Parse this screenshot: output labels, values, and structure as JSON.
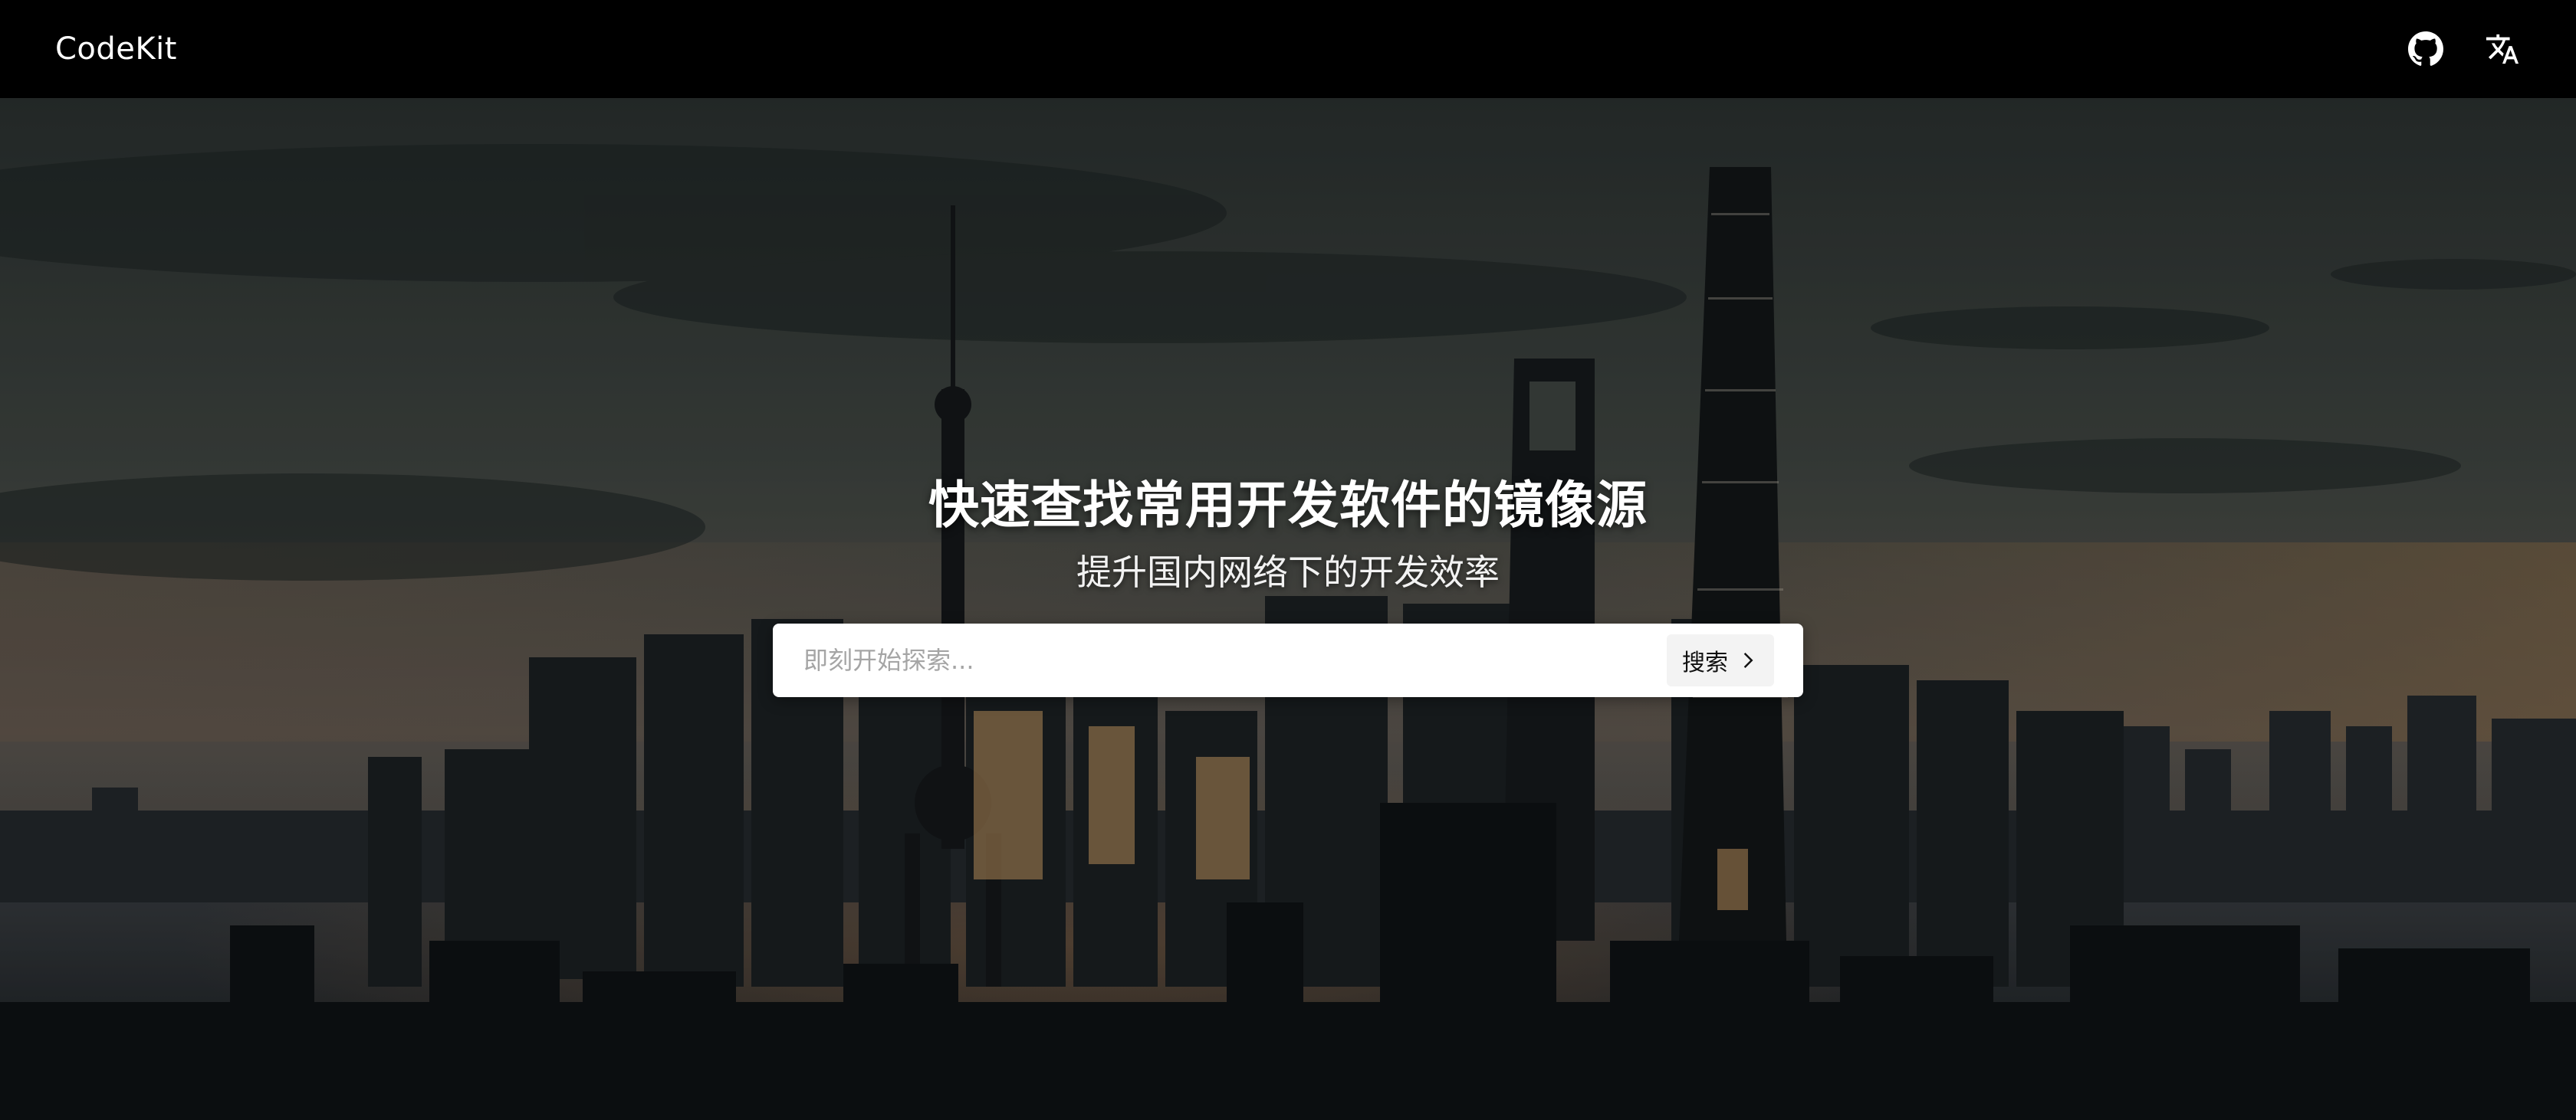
{
  "header": {
    "brand": "CodeKit",
    "github_icon": "github-icon",
    "language_icon": "translate-icon"
  },
  "hero": {
    "title": "快速查找常用开发软件的镜像源",
    "subtitle": "提升国内网络下的开发效率",
    "search": {
      "placeholder": "即刻开始探索...",
      "value": "",
      "button_label": "搜索",
      "button_icon": "chevron-right-icon"
    }
  },
  "colors": {
    "header_bg": "#000000",
    "text": "#ffffff",
    "search_bg": "#ffffff",
    "button_bg": "#f3f3f3"
  }
}
